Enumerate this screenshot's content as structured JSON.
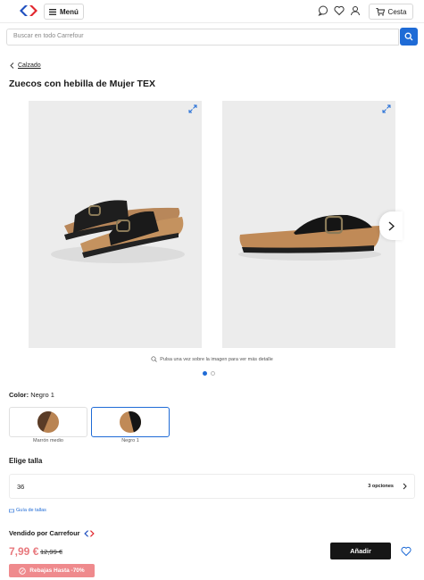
{
  "header": {
    "logo_icon": "carrefour-logo-icon",
    "menu_label": "Menú",
    "cart_label": "Cesta",
    "icons": [
      "chat-icon",
      "heart-icon",
      "user-icon",
      "cart-icon"
    ]
  },
  "search": {
    "placeholder": "Buscar en todo Carrefour",
    "icon": "search-icon"
  },
  "breadcrumb": {
    "back_label": "Calzado"
  },
  "product": {
    "title": "Zuecos con hebilla de Mujer TEX",
    "images": [
      "Sandals pair, three-quarter view",
      "Single sandal, side view"
    ],
    "zoom_hint": "Pulsa una vez sobre la imagen para ver más detalle",
    "carousel_active": 1,
    "carousel_count": 2
  },
  "color": {
    "label": "Color:",
    "selected": "Negro 1",
    "options": [
      {
        "name": "Marrón medio",
        "selected": false
      },
      {
        "name": "Negro 1",
        "selected": true
      }
    ]
  },
  "size": {
    "title": "Elige talla",
    "value": "36",
    "options_count": "3 opciones",
    "guide_label": "Guía de tallas"
  },
  "purchase": {
    "seller_label": "Vendido por Carrefour",
    "price": "7,99 €",
    "old_price": "12,99 €",
    "promo": "Rebajas Hasta -70%",
    "add_label": "Añadir"
  },
  "colors": {
    "accent": "#1f6bd6",
    "price": "#e8787d",
    "promo_bg": "#ef8a8d",
    "add_bg": "#161616"
  }
}
